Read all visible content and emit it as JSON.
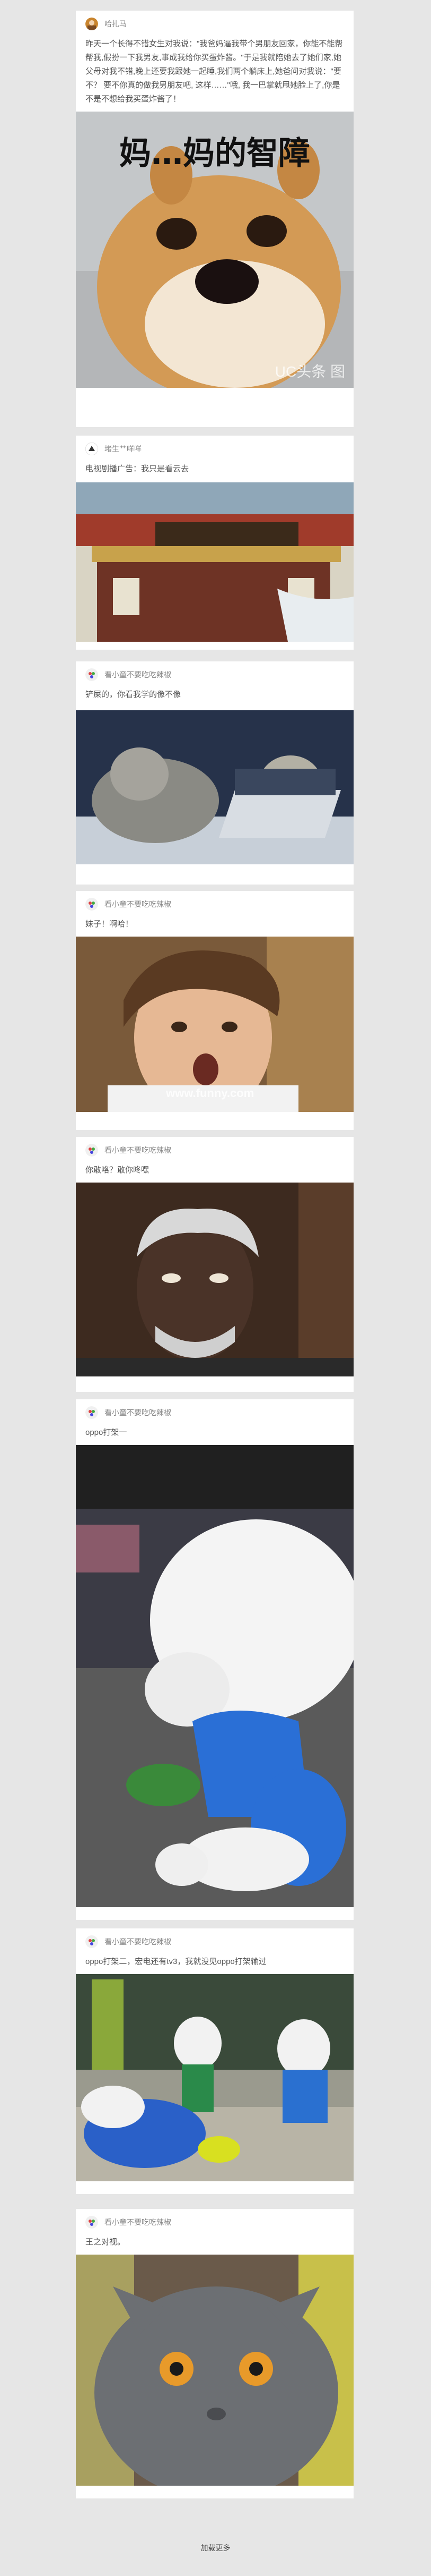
{
  "posts": [
    {
      "author": "哈扎马",
      "text": "昨天一个长得不错女生对我说：\"我爸妈逼我带个男朋友回家，你能不能帮帮我,假扮一下我男友,事成我给你买蛋炸酱。\"于是我就陪她去了她们家,她父母对我不错,晚上还要我跟她一起睡,我们两个躺床上,她爸问对我说：\"要不？ 要不你真的做我男朋友吧, 这样……\"哦, 我一巴掌就甩她脸上了,你是不是不想给我买蛋炸酱了！",
      "caption": "妈…妈的智障",
      "watermark": "UC头条 图"
    },
    {
      "author": "堵生艹咩咩",
      "text": "电视剧播广告：我只是看云去"
    },
    {
      "author": "看小童不要吃吃辣椒",
      "text": "铲屎的，你看我学的像不像"
    },
    {
      "author": "看小童不要吃吃辣椒",
      "text": "妹子！啊哈！",
      "watermark": "www.funny.com"
    },
    {
      "author": "看小童不要吃吃辣椒",
      "text": "你敢咯？敢你咚嘿"
    },
    {
      "author": "看小童不要吃吃辣椒",
      "text": "oppo打架一"
    },
    {
      "author": "看小童不要吃吃辣椒",
      "text": "oppo打架二，宏电还有tv3，我就没见oppo打架输过"
    },
    {
      "author": "看小童不要吃吃辣椒",
      "text": "王之对视。"
    }
  ],
  "load_more": "加载更多",
  "colors": {
    "background": "#e6e6e6",
    "card": "#ffffff",
    "author": "#888888",
    "text": "#555555"
  }
}
